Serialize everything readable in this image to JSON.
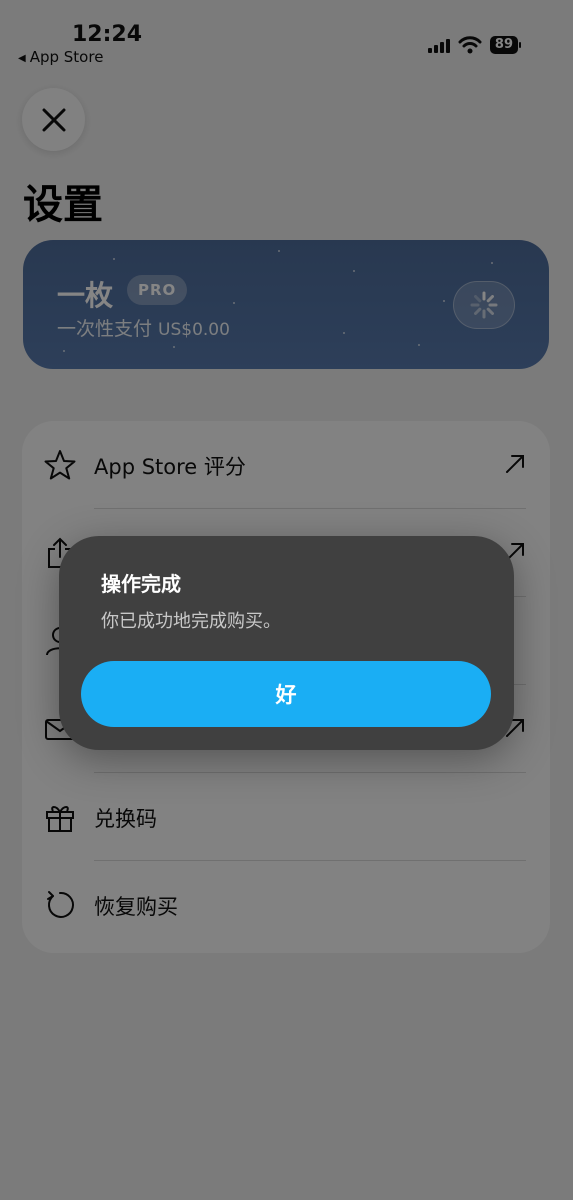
{
  "status_bar": {
    "time": "12:24",
    "back_label": "App Store",
    "battery": "89"
  },
  "page": {
    "title": "设置"
  },
  "pro_card": {
    "name": "一枚",
    "badge": "PRO",
    "subtitle": "一次性支付",
    "price": "US$0.00",
    "accent_color": "#5779ac"
  },
  "settings": {
    "items": [
      {
        "label": "App Store 评分",
        "icon": "star-icon",
        "external": true
      },
      {
        "label": "",
        "icon": "share-icon",
        "external": true
      },
      {
        "label": "",
        "icon": "person-icon",
        "external": false
      },
      {
        "label": "",
        "icon": "mail-icon",
        "external": true
      },
      {
        "label": "兑换码",
        "icon": "gift-icon",
        "external": false
      },
      {
        "label": "恢复购买",
        "icon": "restore-icon",
        "external": false
      }
    ]
  },
  "alert": {
    "title": "操作完成",
    "message": "你已成功地完成购买。",
    "ok_label": "好",
    "button_color": "#1aaef4"
  }
}
